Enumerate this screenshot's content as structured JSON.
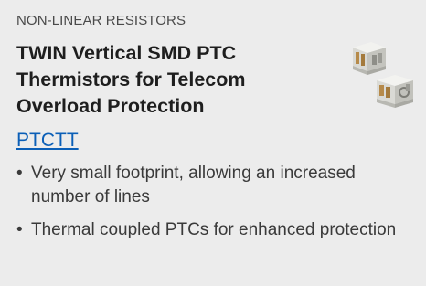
{
  "card": {
    "category": "NON-LINEAR RESISTORS",
    "title": "TWIN Vertical SMD PTC Thermistors for Telecom Overload Protection",
    "part_link": "PTCTT",
    "features": [
      "Very small footprint, allowing an increased number of lines",
      "Thermal coupled PTCs for enhanced protection"
    ],
    "bullet": "•",
    "image_icon": "smd-component-image"
  }
}
